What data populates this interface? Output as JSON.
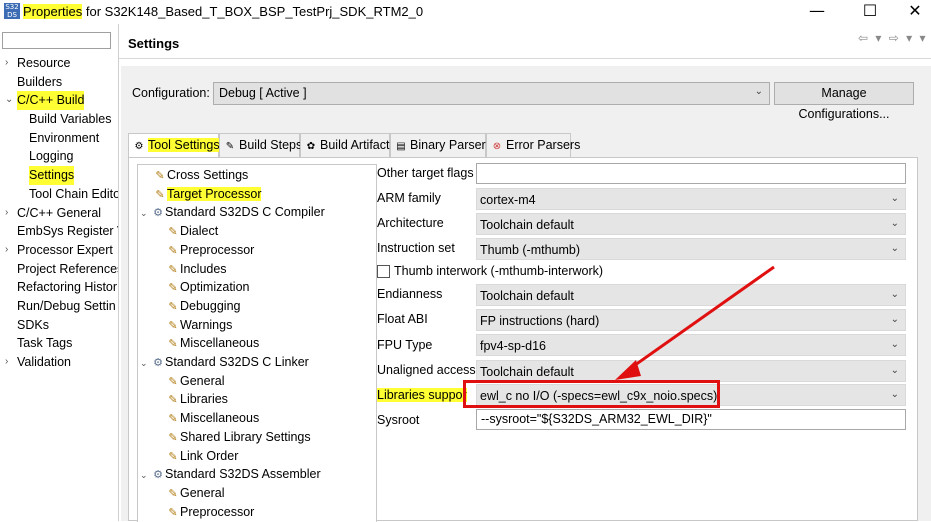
{
  "window": {
    "icon_text": "S32 DS",
    "title_highlight": "Properties",
    "title_rest": " for S32K148_Based_T_BOX_BSP_TestPrj_SDK_RTM2_0",
    "minimize": "—",
    "maximize": "☐",
    "close": "✕"
  },
  "sidebar": {
    "items": [
      {
        "label": "Resource",
        "arrow": "›"
      },
      {
        "label": "Builders",
        "arrow": ""
      },
      {
        "label": "C/C++ Build",
        "arrow": "⌄"
      },
      {
        "label": "Build Variables",
        "arrow": ""
      },
      {
        "label": "Environment",
        "arrow": ""
      },
      {
        "label": "Logging",
        "arrow": ""
      },
      {
        "label": "Settings",
        "arrow": ""
      },
      {
        "label": "Tool Chain Edito",
        "arrow": ""
      },
      {
        "label": "C/C++ General",
        "arrow": "›"
      },
      {
        "label": "EmbSys Register V",
        "arrow": ""
      },
      {
        "label": "Processor Expert",
        "arrow": "›"
      },
      {
        "label": "Project References",
        "arrow": ""
      },
      {
        "label": "Refactoring Histor",
        "arrow": ""
      },
      {
        "label": "Run/Debug Settin",
        "arrow": ""
      },
      {
        "label": "SDKs",
        "arrow": ""
      },
      {
        "label": "Task Tags",
        "arrow": ""
      },
      {
        "label": "Validation",
        "arrow": "›"
      }
    ]
  },
  "header": {
    "title": "Settings",
    "nav_arrows": "⇦ ▾ ⇨ ▾ ▾"
  },
  "config": {
    "label": "Configuration:",
    "value": "Debug  [ Active ]",
    "manage_label": "Manage Configurations..."
  },
  "tabs": [
    {
      "label": "Tool Settings",
      "icon": "⚙"
    },
    {
      "label": "Build Steps",
      "icon": "✎"
    },
    {
      "label": "Build Artifact",
      "icon": "✿"
    },
    {
      "label": "Binary Parsers",
      "icon": "▤"
    },
    {
      "label": "Error Parsers",
      "icon": "⊗"
    }
  ],
  "tree": [
    {
      "label": "Cross Settings",
      "level": 1
    },
    {
      "label": "Target Processor",
      "level": 1
    },
    {
      "label": "Standard S32DS C Compiler",
      "level": 0
    },
    {
      "label": "Dialect",
      "level": 2
    },
    {
      "label": "Preprocessor",
      "level": 2
    },
    {
      "label": "Includes",
      "level": 2
    },
    {
      "label": "Optimization",
      "level": 2
    },
    {
      "label": "Debugging",
      "level": 2
    },
    {
      "label": "Warnings",
      "level": 2
    },
    {
      "label": "Miscellaneous",
      "level": 2
    },
    {
      "label": "Standard S32DS C Linker",
      "level": 0
    },
    {
      "label": "General",
      "level": 2
    },
    {
      "label": "Libraries",
      "level": 2
    },
    {
      "label": "Miscellaneous",
      "level": 2
    },
    {
      "label": "Shared Library Settings",
      "level": 2
    },
    {
      "label": "Link Order",
      "level": 2
    },
    {
      "label": "Standard S32DS Assembler",
      "level": 0
    },
    {
      "label": "General",
      "level": 2
    },
    {
      "label": "Preprocessor",
      "level": 2
    }
  ],
  "form": {
    "other_flags_label": "Other target flags",
    "other_flags_value": "",
    "arm_family_label": "ARM family",
    "arm_family_value": "cortex-m4",
    "architecture_label": "Architecture",
    "architecture_value": "Toolchain default",
    "instruction_set_label": "Instruction set",
    "instruction_set_value": "Thumb (-mthumb)",
    "thumb_interwork_label": "Thumb interwork (-mthumb-interwork)",
    "endianness_label": "Endianness",
    "endianness_value": "Toolchain default",
    "float_abi_label": "Float ABI",
    "float_abi_value": "FP instructions (hard)",
    "fpu_type_label": "FPU Type",
    "fpu_type_value": "fpv4-sp-d16",
    "unaligned_label": "Unaligned access",
    "unaligned_value": "Toolchain default",
    "libraries_label": "Libraries suppor",
    "libraries_value": "ewl_c no I/O (-specs=ewl_c9x_noio.specs)",
    "sysroot_label": "Sysroot",
    "sysroot_value": "--sysroot=\"${S32DS_ARM32_EWL_DIR}\""
  },
  "colors": {
    "highlight": "#ffff33",
    "annotation_red": "#e01010"
  },
  "icons": {
    "dropdown": "⌄"
  }
}
